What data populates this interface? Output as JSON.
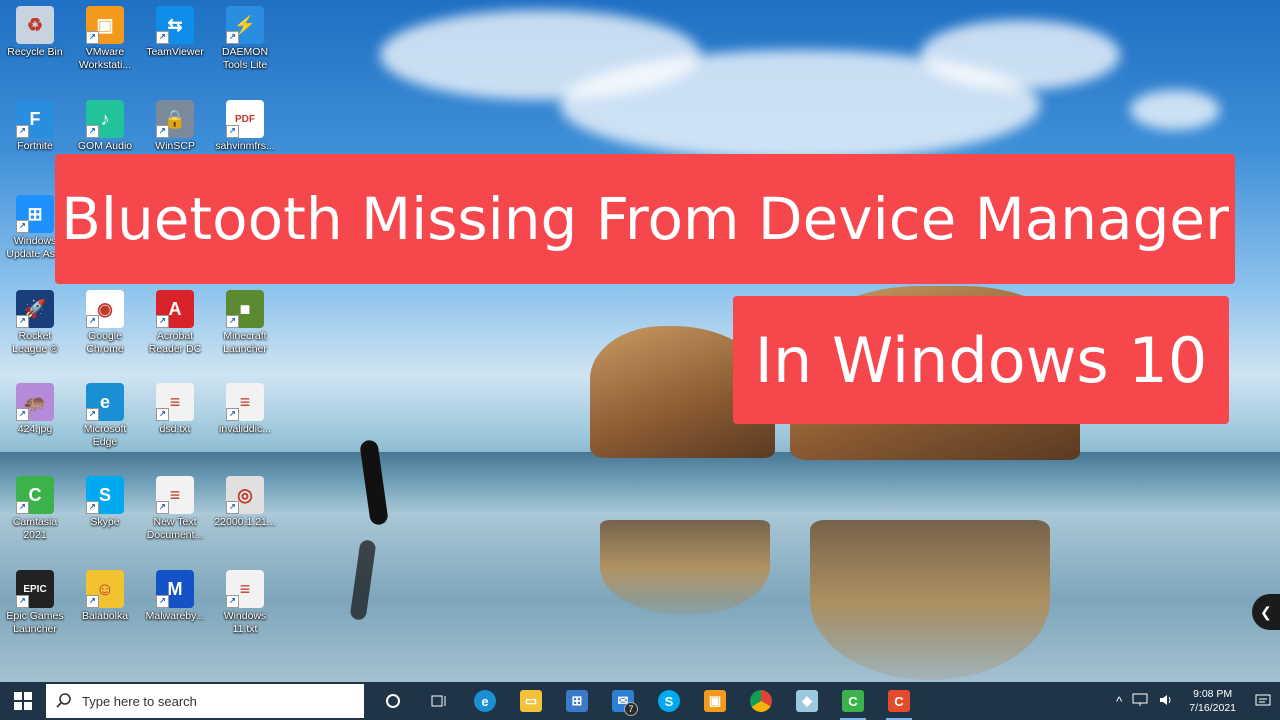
{
  "desktop": {
    "icons": [
      {
        "label": "Recycle Bin",
        "icon": "recycle-bin-icon",
        "color": "#c7d4e0",
        "glyph": "♻"
      },
      {
        "label": "VMware\nWorkstati...",
        "icon": "vmware-icon",
        "color": "#f39a1d",
        "glyph": "▣"
      },
      {
        "label": "TeamViewer",
        "icon": "teamviewer-icon",
        "color": "#0e8ee9",
        "glyph": "⇆"
      },
      {
        "label": "DAEMON\nTools Lite",
        "icon": "daemon-tools-icon",
        "color": "#2a8ee0",
        "glyph": "⚡"
      },
      {
        "label": "Fortnite",
        "icon": "fortnite-icon",
        "color": "#2a8ee0",
        "glyph": "F"
      },
      {
        "label": "GOM Audio",
        "icon": "gom-audio-icon",
        "color": "#22c29a",
        "glyph": "♪"
      },
      {
        "label": "WinSCP",
        "icon": "winscp-icon",
        "color": "#7a8a9a",
        "glyph": "🔒"
      },
      {
        "label": "sahvinmfrs...",
        "icon": "pdf-file-icon",
        "color": "#ffffff",
        "glyph": "PDF"
      },
      {
        "label": "Windows\nUpdate As...",
        "icon": "windows-update-icon",
        "color": "#1e90ff",
        "glyph": "⊞"
      },
      {
        "label": "Rocket\nLeague ®",
        "icon": "rocket-league-icon",
        "color": "#1a3e7a",
        "glyph": "🚀"
      },
      {
        "label": "Google\nChrome",
        "icon": "chrome-icon",
        "color": "#ffffff",
        "glyph": "◉"
      },
      {
        "label": "Acrobat\nReader DC",
        "icon": "acrobat-icon",
        "color": "#d8232a",
        "glyph": "A"
      },
      {
        "label": "Minecraft\nLauncher",
        "icon": "minecraft-icon",
        "color": "#5c8a33",
        "glyph": "■"
      },
      {
        "label": "424.jpg",
        "icon": "image-file-icon",
        "color": "#b58ad8",
        "glyph": "🦛"
      },
      {
        "label": "Microsoft\nEdge",
        "icon": "edge-icon",
        "color": "#1a8fd4",
        "glyph": "e"
      },
      {
        "label": "dsd.txt",
        "icon": "text-file-icon",
        "color": "#f2f2f2",
        "glyph": "≡"
      },
      {
        "label": "invaliddic...",
        "icon": "text-file-icon",
        "color": "#f2f2f2",
        "glyph": "≡"
      },
      {
        "label": "Camtasia\n2021",
        "icon": "camtasia-icon",
        "color": "#3bb34a",
        "glyph": "C"
      },
      {
        "label": "Skype",
        "icon": "skype-icon",
        "color": "#00a9f0",
        "glyph": "S"
      },
      {
        "label": "New Text\nDocument...",
        "icon": "text-file-icon",
        "color": "#f2f2f2",
        "glyph": "≡"
      },
      {
        "label": "22000.1.21...",
        "icon": "disc-image-icon",
        "color": "#e0e0e0",
        "glyph": "◎"
      },
      {
        "label": "Epic Games\nLauncher",
        "icon": "epic-games-icon",
        "color": "#222222",
        "glyph": "EPIC"
      },
      {
        "label": "Balabolka",
        "icon": "balabolka-icon",
        "color": "#f2c230",
        "glyph": "☺"
      },
      {
        "label": "Malwareby...",
        "icon": "malwarebytes-icon",
        "color": "#1452c8",
        "glyph": "M"
      },
      {
        "label": "Windows\n11.txt",
        "icon": "text-file-icon",
        "color": "#f2f2f2",
        "glyph": "≡"
      }
    ]
  },
  "banner": {
    "line1": "Bluetooth Missing From Device Manager",
    "line2": "In Windows 10",
    "color": "#f5474c"
  },
  "taskbar": {
    "search_placeholder": "Type here to search",
    "mail_badge": "7",
    "clock_time": "9:08 PM",
    "clock_date": "7/16/2021",
    "tray_expand": "^",
    "accent": "#1f3547"
  }
}
